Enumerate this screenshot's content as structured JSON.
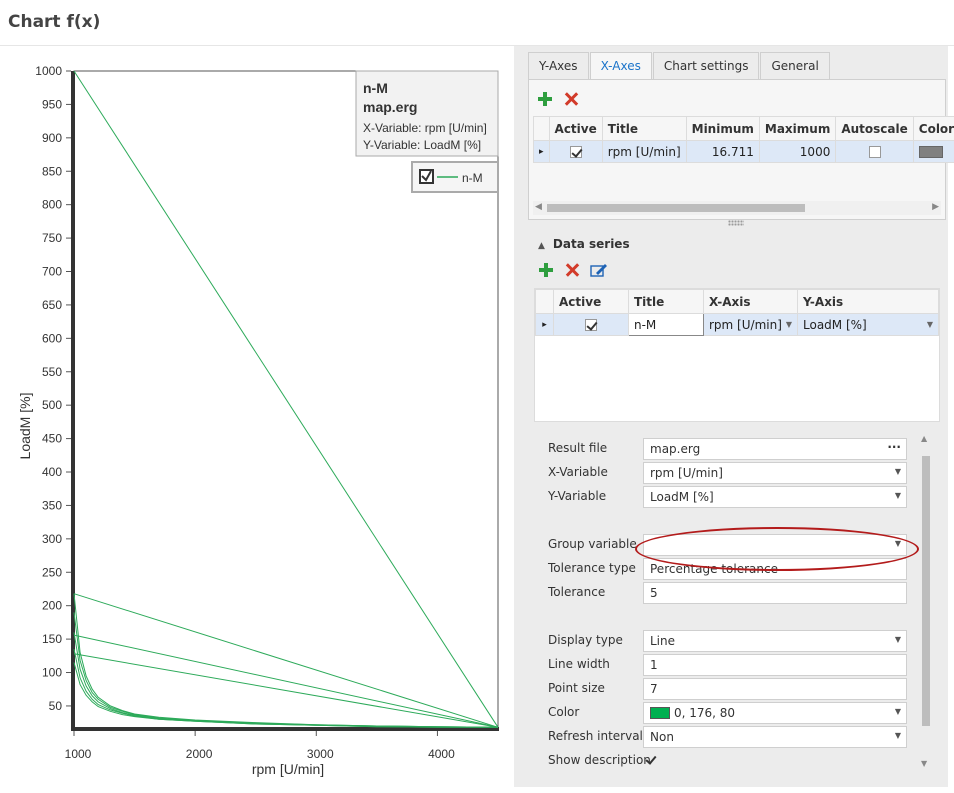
{
  "page_title": "Chart f(x)",
  "chart": {
    "info_title": "n-M",
    "info_file": "map.erg",
    "info_x": "X-Variable: rpm [U/min]",
    "info_y": "Y-Variable: LoadM [%]",
    "legend_label": "n-M",
    "line_color": "#2daa5a"
  },
  "chart_data": {
    "type": "line",
    "xlabel": "rpm [U/min]",
    "ylabel": "LoadM [%]",
    "xlim": [
      1000,
      4500
    ],
    "ylim": [
      14,
      1000
    ],
    "x_ticks": [
      1000,
      2000,
      3000,
      4000
    ],
    "y_ticks": [
      50,
      100,
      150,
      200,
      250,
      300,
      350,
      400,
      450,
      500,
      550,
      600,
      650,
      700,
      750,
      800,
      850,
      900,
      950,
      1000
    ],
    "grid": false,
    "series": [
      {
        "name": "n-M",
        "x": [
          1000,
          4500
        ],
        "y": [
          1000,
          18
        ]
      },
      {
        "x": [
          1000,
          4500
        ],
        "y": [
          218,
          18
        ]
      },
      {
        "x": [
          1000,
          4500
        ],
        "y": [
          156,
          18
        ]
      },
      {
        "x": [
          1000,
          4500
        ],
        "y": [
          128,
          18
        ]
      },
      {
        "x": [
          1000,
          1050,
          1100,
          1150,
          1200,
          1300,
          1400,
          1500,
          1700,
          2000,
          2500,
          3000,
          3500,
          4000,
          4500
        ],
        "y": [
          218,
          130,
          95,
          75,
          63,
          50,
          43,
          38,
          33,
          29,
          25,
          22,
          20,
          19,
          18
        ]
      },
      {
        "x": [
          1000,
          1050,
          1100,
          1150,
          1200,
          1300,
          1400,
          1500,
          1700,
          2000,
          2500,
          3000,
          3500,
          4000,
          4500
        ],
        "y": [
          190,
          118,
          88,
          70,
          60,
          48,
          42,
          37,
          32,
          28,
          24,
          22,
          20,
          19,
          18
        ]
      },
      {
        "x": [
          1000,
          1050,
          1100,
          1150,
          1200,
          1300,
          1400,
          1500,
          1700,
          2000,
          2500,
          3000,
          3500,
          4000,
          4500
        ],
        "y": [
          160,
          105,
          80,
          65,
          56,
          46,
          40,
          36,
          31,
          28,
          24,
          21,
          20,
          19,
          18
        ]
      },
      {
        "x": [
          1000,
          1050,
          1100,
          1150,
          1200,
          1300,
          1400,
          1500,
          1700,
          2000,
          2500,
          3000,
          3500,
          4000,
          4500
        ],
        "y": [
          135,
          92,
          72,
          60,
          52,
          44,
          39,
          35,
          30,
          27,
          23,
          21,
          19,
          18,
          18
        ]
      },
      {
        "x": [
          1000,
          1050,
          1100,
          1150,
          1200,
          1300,
          1400,
          1500,
          1700,
          2000,
          2500,
          3000,
          3500,
          4000,
          4500
        ],
        "y": [
          115,
          82,
          66,
          56,
          49,
          42,
          37,
          34,
          30,
          27,
          23,
          21,
          19,
          18,
          18
        ]
      }
    ]
  },
  "axes_panel": {
    "tabs": [
      {
        "label": "Y-Axes"
      },
      {
        "label": "X-Axes"
      },
      {
        "label": "Chart settings"
      },
      {
        "label": "General"
      }
    ],
    "columns": [
      "Active",
      "Title",
      "Minimum",
      "Maximum",
      "Autoscale",
      "Color"
    ],
    "rows": [
      {
        "active": true,
        "title": "rpm [U/min]",
        "minimum": "16.711",
        "maximum": "1000",
        "autoscale": false,
        "color": "#808080"
      }
    ]
  },
  "series_panel": {
    "header": "Data series",
    "columns": [
      "Active",
      "Title",
      "X-Axis",
      "Y-Axis"
    ],
    "rows": [
      {
        "active": true,
        "title": "n-M",
        "x_axis": "rpm [U/min]",
        "y_axis": "LoadM [%]"
      }
    ]
  },
  "properties": {
    "result_file_label": "Result file",
    "result_file_value": "map.erg",
    "x_variable_label": "X-Variable",
    "x_variable_value": "rpm [U/min]",
    "y_variable_label": "Y-Variable",
    "y_variable_value": "LoadM [%]",
    "group_variable_label": "Group variable",
    "group_variable_value": "",
    "tolerance_type_label": "Tolerance type",
    "tolerance_type_value": "Percentage tolerance",
    "tolerance_label": "Tolerance",
    "tolerance_value": "5",
    "display_type_label": "Display type",
    "display_type_value": "Line",
    "line_width_label": "Line width",
    "line_width_value": "1",
    "point_size_label": "Point size",
    "point_size_value": "7",
    "color_label": "Color",
    "color_value": "0, 176, 80",
    "color_hex": "#00b050",
    "refresh_interval_label": "Refresh interval",
    "refresh_interval_value": "Non",
    "show_description_label": "Show description",
    "show_description_checked": true
  }
}
